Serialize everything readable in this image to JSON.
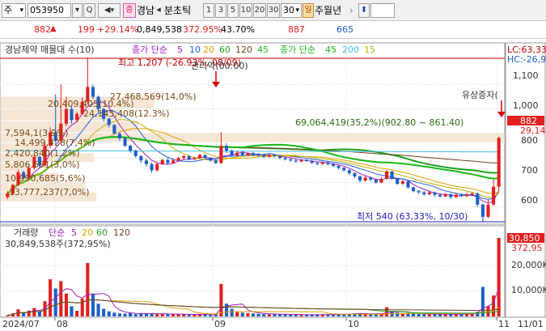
{
  "toolbar": {
    "type_select": "주",
    "code_input": "053950",
    "dropdown_btn": "▾",
    "search_btn": "Q",
    "sound_btn": "◀",
    "badge_jeung": "증",
    "stock_name": "경남",
    "nav_prev": "◂",
    "tick_label": "분초틱",
    "intervals": [
      "1",
      "3",
      "5",
      "10",
      "20",
      "30"
    ],
    "period_value": "30",
    "period_dropdown": "▾",
    "badge_day": "일",
    "tail_label": "주월년",
    "tail_arrow": "›",
    "updown_btn": "⬍"
  },
  "quote": {
    "price": "882",
    "change_arrow": "▲",
    "change": "199",
    "change_pct": "+29.14%",
    "volume": "0,849,538",
    "volume_pct": "372.95%",
    "turnover": "43.70%",
    "high": "887",
    "low": "665"
  },
  "price_legend": {
    "name": "경남제약 매물대 수(10)",
    "ma1_label": "종가 단순",
    "ma1_periods": [
      "5",
      "10",
      "20",
      "60",
      "120",
      "45"
    ],
    "ma2_label": "종가 단순",
    "ma2_periods": [
      "45",
      "200",
      "15"
    ]
  },
  "axis_right": {
    "lc": "LC:63,33",
    "hc": "HC:-26,9",
    "price_ticks": [
      "1,100",
      "1,000",
      "900",
      "800",
      "700",
      "600"
    ],
    "current_price": "882",
    "current_pct": "29,14%",
    "volume_ticks": [
      "20,000K",
      "10,000K"
    ],
    "current_volume": "30,850",
    "current_volume_pct": "372,95"
  },
  "annotations": {
    "high": "최고 1,207 (-26.93%, 08/09)",
    "event_top": "관리약(00:00)",
    "low": "최저 540 (63,33%, 10/30)",
    "event_right": "유상증자(",
    "zone_main": "69,064,419(35,2%)(902.80 ~ 861.40)"
  },
  "profile_labels": [
    "20,409,405(10.4%)",
    "27,468,569(14,0%)",
    "24,145,408(12.3%)",
    "7,594,1(3,9%)",
    "14,499,428(7,4%)",
    "2,420,840(1,2%)",
    "5,806,681(3,0%)",
    "10,990,685(5,6%)",
    "13,777,237(7,0%)"
  ],
  "volume_legend": {
    "label": "거래량",
    "ma_label": "단순",
    "ma_periods": [
      "5",
      "20",
      "60",
      "120"
    ],
    "value": "30,849,538주(372,95%)"
  },
  "date_labels": [
    "2024/07",
    "08",
    "09",
    "10",
    "11",
    "11/01"
  ],
  "colors": {
    "up": "#e02020",
    "down": "#1e5fc8",
    "ma5": "#a020c0",
    "ma10": "#2060e0",
    "ma20": "#e0a000",
    "ma60": "#20a020",
    "ma120": "#704020",
    "ma45": "#18b818",
    "ma200": "#40c0e0",
    "ma15": "#c0b000",
    "zone": "#f3e2cf",
    "lc_line": "#c00000",
    "low_line": "#2020c0"
  },
  "chart_data": {
    "type": "candlestick",
    "range": {
      "price_min": 540,
      "price_max": 1207,
      "volume_max_k": 30850
    },
    "candles": [
      {
        "o": 640,
        "c": 655,
        "h": 665,
        "l": 632,
        "v": 400
      },
      {
        "o": 655,
        "c": 690,
        "h": 695,
        "l": 650,
        "v": 1200
      },
      {
        "o": 690,
        "c": 742,
        "h": 752,
        "l": 685,
        "v": 2800
      },
      {
        "o": 742,
        "c": 718,
        "h": 748,
        "l": 710,
        "v": 1500
      },
      {
        "o": 718,
        "c": 760,
        "h": 770,
        "l": 712,
        "v": 2300
      },
      {
        "o": 760,
        "c": 805,
        "h": 818,
        "l": 752,
        "v": 3300
      },
      {
        "o": 805,
        "c": 770,
        "h": 808,
        "l": 760,
        "v": 2000
      },
      {
        "o": 770,
        "c": 850,
        "h": 865,
        "l": 765,
        "v": 6000
      },
      {
        "o": 850,
        "c": 905,
        "h": 925,
        "l": 840,
        "v": 14600
      },
      {
        "o": 905,
        "c": 870,
        "h": 1060,
        "l": 858,
        "v": 11000
      },
      {
        "o": 870,
        "c": 940,
        "h": 1100,
        "l": 865,
        "v": 13900
      },
      {
        "o": 940,
        "c": 1000,
        "h": 1050,
        "l": 930,
        "v": 9000
      },
      {
        "o": 1000,
        "c": 955,
        "h": 1010,
        "l": 940,
        "v": 4000
      },
      {
        "o": 955,
        "c": 980,
        "h": 990,
        "l": 945,
        "v": 2200
      },
      {
        "o": 980,
        "c": 1030,
        "h": 1047,
        "l": 975,
        "v": 7000
      },
      {
        "o": 1030,
        "c": 1090,
        "h": 1207,
        "l": 1020,
        "v": 21000
      },
      {
        "o": 1090,
        "c": 1050,
        "h": 1100,
        "l": 1040,
        "v": 9000
      },
      {
        "o": 1050,
        "c": 1000,
        "h": 1055,
        "l": 985,
        "v": 5000
      },
      {
        "o": 1000,
        "c": 960,
        "h": 1005,
        "l": 950,
        "v": 3000
      },
      {
        "o": 960,
        "c": 935,
        "h": 965,
        "l": 925,
        "v": 2000
      },
      {
        "o": 935,
        "c": 900,
        "h": 938,
        "l": 895,
        "v": 1500
      },
      {
        "o": 900,
        "c": 880,
        "h": 905,
        "l": 870,
        "v": 1200
      },
      {
        "o": 880,
        "c": 850,
        "h": 885,
        "l": 845,
        "v": 1100
      },
      {
        "o": 850,
        "c": 830,
        "h": 855,
        "l": 822,
        "v": 1300
      },
      {
        "o": 830,
        "c": 808,
        "h": 835,
        "l": 800,
        "v": 900
      },
      {
        "o": 808,
        "c": 790,
        "h": 812,
        "l": 780,
        "v": 1300
      },
      {
        "o": 790,
        "c": 775,
        "h": 798,
        "l": 765,
        "v": 1100
      },
      {
        "o": 775,
        "c": 750,
        "h": 782,
        "l": 740,
        "v": 1000
      },
      {
        "o": 750,
        "c": 775,
        "h": 785,
        "l": 745,
        "v": 1000
      },
      {
        "o": 775,
        "c": 792,
        "h": 798,
        "l": 770,
        "v": 1000
      },
      {
        "o": 792,
        "c": 780,
        "h": 800,
        "l": 772,
        "v": 900
      },
      {
        "o": 780,
        "c": 790,
        "h": 800,
        "l": 778,
        "v": 800
      },
      {
        "o": 790,
        "c": 800,
        "h": 805,
        "l": 785,
        "v": 900
      },
      {
        "o": 800,
        "c": 808,
        "h": 812,
        "l": 796,
        "v": 800
      },
      {
        "o": 808,
        "c": 795,
        "h": 812,
        "l": 790,
        "v": 700
      },
      {
        "o": 795,
        "c": 800,
        "h": 805,
        "l": 790,
        "v": 800
      },
      {
        "o": 800,
        "c": 812,
        "h": 818,
        "l": 796,
        "v": 900
      },
      {
        "o": 812,
        "c": 800,
        "h": 815,
        "l": 795,
        "v": 700
      },
      {
        "o": 800,
        "c": 790,
        "h": 804,
        "l": 785,
        "v": 600
      },
      {
        "o": 790,
        "c": 780,
        "h": 795,
        "l": 775,
        "v": 800
      },
      {
        "o": 780,
        "c": 850,
        "h": 905,
        "l": 775,
        "v": 12800
      },
      {
        "o": 850,
        "c": 830,
        "h": 860,
        "l": 820,
        "v": 5000
      },
      {
        "o": 830,
        "c": 810,
        "h": 835,
        "l": 805,
        "v": 3000
      },
      {
        "o": 810,
        "c": 822,
        "h": 830,
        "l": 805,
        "v": 2000
      },
      {
        "o": 822,
        "c": 812,
        "h": 827,
        "l": 808,
        "v": 1500
      },
      {
        "o": 812,
        "c": 820,
        "h": 824,
        "l": 808,
        "v": 1300
      },
      {
        "o": 820,
        "c": 815,
        "h": 825,
        "l": 808,
        "v": 1200
      },
      {
        "o": 815,
        "c": 810,
        "h": 820,
        "l": 805,
        "v": 1000
      },
      {
        "o": 810,
        "c": 805,
        "h": 815,
        "l": 800,
        "v": 900
      },
      {
        "o": 805,
        "c": 812,
        "h": 818,
        "l": 802,
        "v": 900
      },
      {
        "o": 812,
        "c": 808,
        "h": 816,
        "l": 802,
        "v": 900
      },
      {
        "o": 808,
        "c": 800,
        "h": 812,
        "l": 795,
        "v": 800
      },
      {
        "o": 800,
        "c": 795,
        "h": 805,
        "l": 790,
        "v": 800
      },
      {
        "o": 795,
        "c": 790,
        "h": 800,
        "l": 785,
        "v": 700
      },
      {
        "o": 790,
        "c": 786,
        "h": 795,
        "l": 780,
        "v": 700
      },
      {
        "o": 786,
        "c": 792,
        "h": 796,
        "l": 782,
        "v": 700
      },
      {
        "o": 792,
        "c": 788,
        "h": 795,
        "l": 784,
        "v": 600
      },
      {
        "o": 788,
        "c": 780,
        "h": 792,
        "l": 776,
        "v": 700
      },
      {
        "o": 780,
        "c": 776,
        "h": 785,
        "l": 770,
        "v": 800
      },
      {
        "o": 776,
        "c": 782,
        "h": 786,
        "l": 772,
        "v": 700
      },
      {
        "o": 782,
        "c": 775,
        "h": 786,
        "l": 770,
        "v": 700
      },
      {
        "o": 775,
        "c": 768,
        "h": 780,
        "l": 762,
        "v": 800
      },
      {
        "o": 768,
        "c": 760,
        "h": 772,
        "l": 752,
        "v": 900
      },
      {
        "o": 760,
        "c": 750,
        "h": 765,
        "l": 744,
        "v": 1000
      },
      {
        "o": 750,
        "c": 738,
        "h": 755,
        "l": 730,
        "v": 1100
      },
      {
        "o": 738,
        "c": 725,
        "h": 742,
        "l": 718,
        "v": 1200
      },
      {
        "o": 725,
        "c": 708,
        "h": 730,
        "l": 700,
        "v": 1300
      },
      {
        "o": 708,
        "c": 720,
        "h": 726,
        "l": 704,
        "v": 900
      },
      {
        "o": 720,
        "c": 712,
        "h": 725,
        "l": 705,
        "v": 800
      },
      {
        "o": 712,
        "c": 700,
        "h": 716,
        "l": 695,
        "v": 1000
      },
      {
        "o": 700,
        "c": 715,
        "h": 722,
        "l": 697,
        "v": 1100
      },
      {
        "o": 715,
        "c": 745,
        "h": 752,
        "l": 712,
        "v": 3600
      },
      {
        "o": 745,
        "c": 715,
        "h": 748,
        "l": 710,
        "v": 1900
      },
      {
        "o": 715,
        "c": 695,
        "h": 720,
        "l": 690,
        "v": 1500
      },
      {
        "o": 695,
        "c": 705,
        "h": 712,
        "l": 690,
        "v": 1100
      },
      {
        "o": 705,
        "c": 680,
        "h": 708,
        "l": 675,
        "v": 1200
      },
      {
        "o": 680,
        "c": 665,
        "h": 684,
        "l": 660,
        "v": 1100
      },
      {
        "o": 665,
        "c": 660,
        "h": 670,
        "l": 652,
        "v": 1000
      },
      {
        "o": 660,
        "c": 652,
        "h": 665,
        "l": 645,
        "v": 900
      },
      {
        "o": 652,
        "c": 660,
        "h": 668,
        "l": 648,
        "v": 900
      },
      {
        "o": 660,
        "c": 650,
        "h": 663,
        "l": 642,
        "v": 900
      },
      {
        "o": 650,
        "c": 643,
        "h": 655,
        "l": 638,
        "v": 900
      },
      {
        "o": 643,
        "c": 652,
        "h": 658,
        "l": 640,
        "v": 900
      },
      {
        "o": 652,
        "c": 640,
        "h": 655,
        "l": 633,
        "v": 900
      },
      {
        "o": 640,
        "c": 650,
        "h": 660,
        "l": 638,
        "v": 900
      },
      {
        "o": 650,
        "c": 645,
        "h": 655,
        "l": 640,
        "v": 900
      },
      {
        "o": 645,
        "c": 650,
        "h": 658,
        "l": 640,
        "v": 1200
      },
      {
        "o": 650,
        "c": 655,
        "h": 662,
        "l": 645,
        "v": 1300
      },
      {
        "o": 655,
        "c": 610,
        "h": 660,
        "l": 600,
        "v": 1800
      },
      {
        "o": 610,
        "c": 560,
        "h": 615,
        "l": 540,
        "v": 11600
      },
      {
        "o": 560,
        "c": 610,
        "h": 630,
        "l": 555,
        "v": 4000
      },
      {
        "o": 610,
        "c": 683,
        "h": 712,
        "l": 605,
        "v": 8200
      },
      {
        "o": 683,
        "c": 882,
        "h": 887,
        "l": 665,
        "v": 30850
      }
    ]
  }
}
